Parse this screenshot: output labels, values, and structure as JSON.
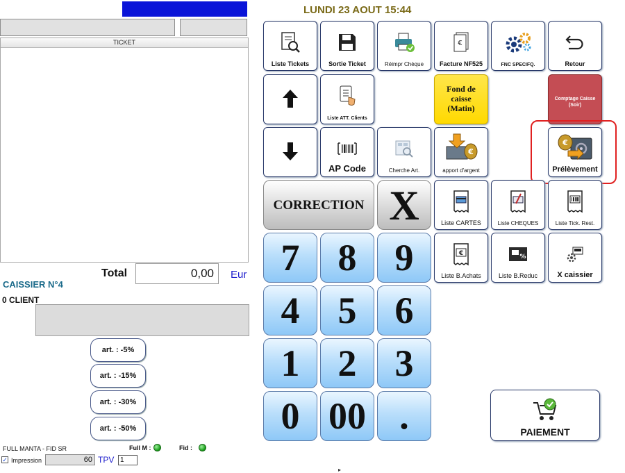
{
  "header": {
    "date_time": "LUNDI 23 AOUT 15:44"
  },
  "ticket": {
    "header_label": "TICKET",
    "total_label": "Total",
    "total_value": "0,00",
    "currency": "Eur"
  },
  "cashier": {
    "label": "CAISSIER N°4",
    "client_label": "0 CLIENT"
  },
  "discounts": [
    "art. : -5%",
    "art. : -15%",
    "art. : -30%",
    "art. : -50%"
  ],
  "status": {
    "program_label": "FULL MANTA - FID SR",
    "full_label": "Full M :",
    "fid_label": "Fid :",
    "impression_label": "Impression",
    "impression_checked": "✓",
    "print_value": "60",
    "tpv_label": "TPV",
    "tpv_value": "1"
  },
  "functions": {
    "liste_tickets": "Liste Tickets",
    "sortie_ticket": "Sortie Ticket",
    "reimpr_cheque": "Réimpr Chèque",
    "facture": "Facture NF525",
    "fnc_specif": "FNC SPECIFQ.",
    "retour": "Retour",
    "liste_att_clients": "Liste ATT. Clients",
    "fond_de_caisse_line1": "Fond de",
    "fond_de_caisse_line2": "caisse",
    "fond_de_caisse_line3": "(Matin)",
    "comptage_line1": "Comptage Caisse",
    "comptage_line2": "(Soir)",
    "ap_code": "AP Code",
    "cherche_art": "Cherche Art.",
    "apport_argent": "apport d'argent",
    "prelevement": "Prélèvement",
    "liste_cartes": "Liste CARTES",
    "liste_cheques": "Liste CHEQUES",
    "liste_tick_rest": "Liste Tick. Rest.",
    "liste_b_achats": "Liste B.Achats",
    "liste_b_reduc": "Liste B.Reduc",
    "x_caissier": "X caissier",
    "paiement": "PAIEMENT"
  },
  "keypad": {
    "correction": "CORRECTION",
    "clear": "X",
    "k7": "7",
    "k8": "8",
    "k9": "9",
    "k4": "4",
    "k5": "5",
    "k6": "6",
    "k1": "1",
    "k2": "2",
    "k3": "3",
    "k0": "0",
    "k00": "00",
    "kdot": "."
  },
  "colors": {
    "accent_blue": "#0a14d8",
    "date_gold": "#7a6a18",
    "cashier_teal": "#1a6a8a",
    "fond_yellow": "#ffd900",
    "comptage_red": "#c44d54",
    "highlight_red": "#e02020",
    "key_blue": "#8ec8f7"
  }
}
